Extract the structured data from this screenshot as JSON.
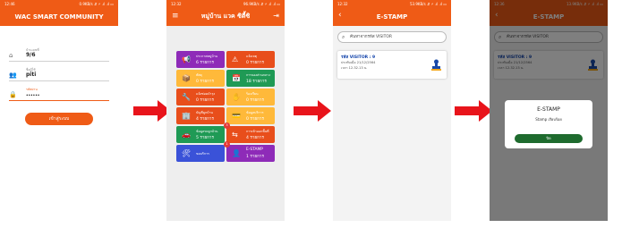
{
  "screen1": {
    "status_time": "12:46",
    "status_right": "0.9KB/s ⇵ ⚡ .ıl .ıl ▭",
    "title": "WAC SMART COMMUNITY",
    "fields": [
      {
        "label": "บ้านเลขที่",
        "value": "9/6",
        "icon": "home-icon"
      },
      {
        "label": "ชื่อผู้ใช้",
        "value": "piti",
        "icon": "user-icon"
      },
      {
        "label": "รหัสผ่าน",
        "value": "••••••",
        "icon": "lock-icon"
      }
    ],
    "login_button": "เข้าสู่ระบบ"
  },
  "screen2": {
    "status_time": "12:32",
    "status_right": "96.9KB/s ⇵ ⚡ .ıl .ıl ▭",
    "title": "หมู่บ้าน แวค ซิตี้ซิ",
    "tiles": [
      {
        "label": "ประกาศหมู่บ้าน",
        "count": "6 รายการ",
        "color": "#8e2bb8",
        "icon": "megaphone-icon"
      },
      {
        "label": "แจ้งเหตุ",
        "count": "0 รายการ",
        "color": "#e84e1b",
        "icon": "warning-icon"
      },
      {
        "label": "พัสดุ",
        "count": "0 รายการ",
        "color": "#ffb93a",
        "icon": "package-icon"
      },
      {
        "label": "การจองส่วนกลาง",
        "count": "18 รายการ",
        "color": "#1f9a55",
        "icon": "calendar-icon"
      },
      {
        "label": "แจ้งซ่อมบำรุง",
        "count": "0 รายการ",
        "color": "#e84e1b",
        "icon": "wrench-icon"
      },
      {
        "label": "ร้องเรียน",
        "count": "0 รายการ",
        "color": "#ffb93a",
        "icon": "complaint-icon"
      },
      {
        "label": "บัญชีลูกบ้าน",
        "count": "4 รายการ",
        "color": "#e84e1b",
        "icon": "building-icon"
      },
      {
        "label": "ข้อมูลบริการ",
        "count": "0 รายการ",
        "color": "#ffb93a",
        "icon": "card-icon"
      },
      {
        "label": "ข้อมูลรถลูกบ้าน",
        "count": "5 รายการ",
        "color": "#1f9a55",
        "icon": "car-icon"
      },
      {
        "label": "การเข้าออกพื้นที่",
        "count": "4 รายการ",
        "color": "#e84e1b",
        "icon": "doors-icon",
        "badge": "3"
      },
      {
        "label": "ขอบริการ",
        "count": "",
        "color": "#3a52d8",
        "icon": "service-icon"
      },
      {
        "label": "E-STAMP",
        "count": "1 รายการ",
        "color": "#8e2bb8",
        "icon": "person-icon",
        "badge": "1"
      }
    ]
  },
  "screen3": {
    "status_time": "12:32",
    "status_right": "53.9KB/s ⇵ ⚡ .ıl .ıl ▭",
    "title": "E-STAMP",
    "search_placeholder": "ค้นหาจากรหัส VISITOR",
    "card": {
      "code": "รหัส VISITOR : 9",
      "date": "ประทับเมื่อ 21/12/2564",
      "time": "เวลา 12.32.13 น."
    }
  },
  "screen4": {
    "status_time": "12:36",
    "status_right": "13.9KB/s ⇵ ⚡ .ıl .ıl ▭",
    "title": "E-STAMP",
    "dialog_title": "E-STAMP",
    "dialog_message": "Stamp เรียบร้อย",
    "dialog_button": "ปิด"
  },
  "colors": {
    "accent": "#ef5b16",
    "arrow": "#e8141b",
    "link": "#0d3fa8"
  }
}
